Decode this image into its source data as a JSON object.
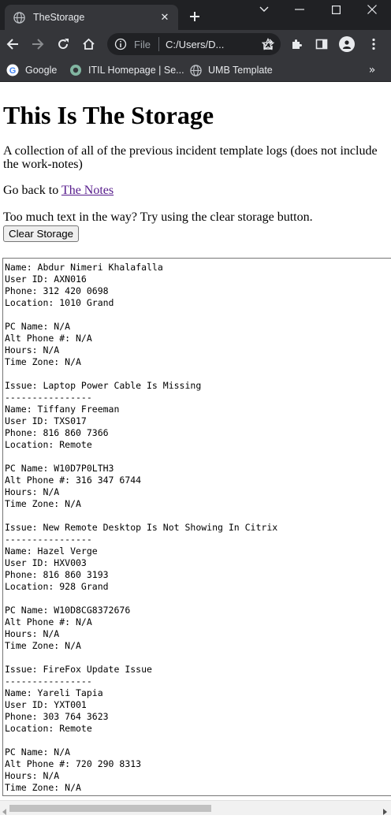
{
  "browser": {
    "tab_title": "TheStorage",
    "url_scheme": "File",
    "url": "C:/Users/D...",
    "bookmarks": [
      {
        "label": "Google"
      },
      {
        "label": "ITIL Homepage | Se..."
      },
      {
        "label": "UMB Template"
      }
    ]
  },
  "page": {
    "title": "This Is The Storage",
    "description": "A collection of all of the previous incident template logs (does not include the work-notes)",
    "back_prefix": "Go back to ",
    "back_link": "The Notes",
    "hint": "Too much text in the way? Try using the clear storage button.",
    "clear_button": "Clear Storage"
  },
  "storage_text": "Name: Abdur Nimeri Khalafalla\nUser ID: AXN016\nPhone: 312 420 0698\nLocation: 1010 Grand\n\nPC Name: N/A\nAlt Phone #: N/A\nHours: N/A\nTime Zone: N/A\n\nIssue: Laptop Power Cable Is Missing\n----------------\nName: Tiffany Freeman\nUser ID: TXS017\nPhone: 816 860 7366\nLocation: Remote\n\nPC Name: W10D7P0LTH3\nAlt Phone #: 316 347 6744\nHours: N/A\nTime Zone: N/A\n\nIssue: New Remote Desktop Is Not Showing In Citrix\n----------------\nName: Hazel Verge\nUser ID: HXV003\nPhone: 816 860 3193\nLocation: 928 Grand\n\nPC Name: W10D8CG8372676\nAlt Phone #: N/A\nHours: N/A\nTime Zone: N/A\n\nIssue: FireFox Update Issue\n----------------\nName: Yareli Tapia\nUser ID: YXT001\nPhone: 303 764 3623\nLocation: Remote\n\nPC Name: N/A\nAlt Phone #: 720 290 8313\nHours: N/A\nTime Zone: N/A"
}
